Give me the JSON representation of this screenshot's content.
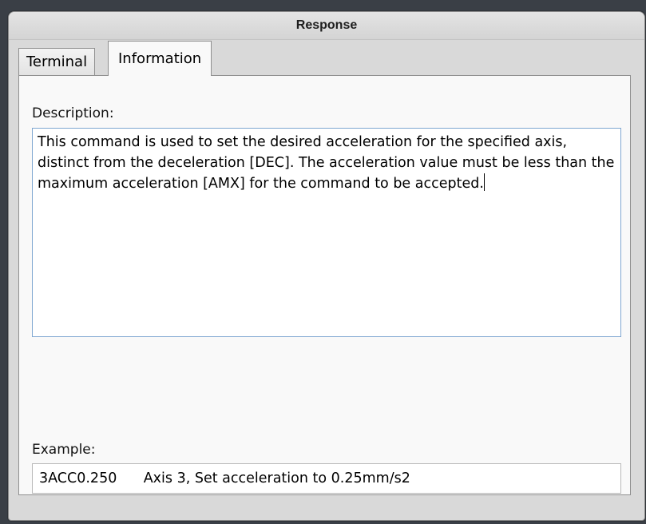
{
  "window": {
    "title": "Response"
  },
  "tabs": [
    {
      "label": "Terminal",
      "selected": false
    },
    {
      "label": "Information",
      "selected": true
    }
  ],
  "information": {
    "description_label": "Description:",
    "description_text": "This command is used to set the desired acceleration for the specified axis, distinct from the deceleration [DEC].   The acceleration value must be less than the maximum acceleration [AMX] for the command to be accepted.",
    "example_label": "Example:",
    "example_text": "3ACC0.250      Axis 3, Set acceleration to 0.25mm/s2"
  },
  "colors": {
    "focus_border": "#7fa7d1",
    "background": "#d9d9d9"
  }
}
